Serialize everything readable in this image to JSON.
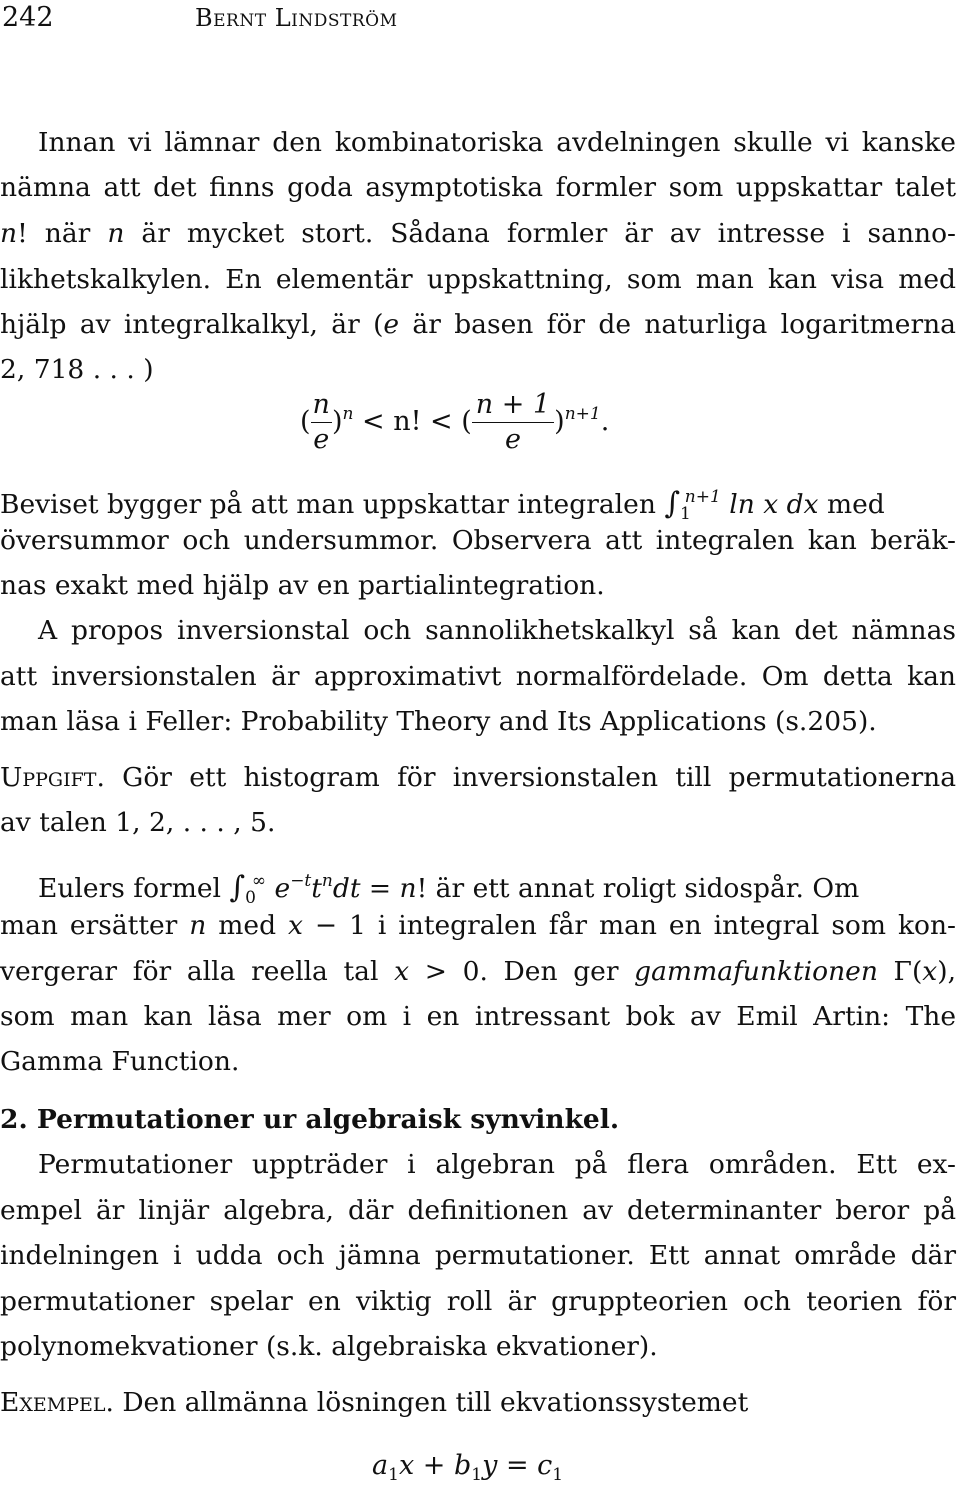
{
  "header": {
    "page_number": "242",
    "running_head": "Bernt Lindström"
  },
  "para1": {
    "l1": "Innan vi lämnar den kombinatoriska avdelningen skulle vi kanske",
    "l2": "nämna att det finns goda asymptotiska formler som uppskattar talet",
    "l3_a": "n",
    "l3_b": "! när ",
    "l3_c": "n",
    "l3_d": " är mycket stort. Sådana formler är av intresse i sanno-",
    "l4": "likhetskalkylen. En elementär uppskattning, som man kan visa med",
    "l5_a": "hjälp av integralkalkyl, är (",
    "l5_b": "e",
    "l5_c": " är basen för de naturliga logaritmerna",
    "l6": "2, 718 . . . )"
  },
  "formula1": {
    "open1": "(",
    "num1": "n",
    "den1": "e",
    "close1": ")",
    "exp1": "n",
    "middle": " < n! < (",
    "num2": "n + 1",
    "den2": "e",
    "close2": ")",
    "exp2": "n+1",
    "period": "."
  },
  "para2": {
    "l1_a": "Beviset bygger på att man uppskattar integralen",
    "l1_int": "∫",
    "l1_lower": "1",
    "l1_upper": "n+1",
    "l1_integrand": "ln x dx",
    "l1_b": "med",
    "l2": "översummor och undersummor. Observera att integralen kan beräk-",
    "l3": "nas exakt med hjälp av en partialintegration."
  },
  "para3": {
    "l1": "A propos inversionstal och sannolikhetskalkyl så kan det nämnas",
    "l2": "att inversionstalen är approximativt normalfördelade. Om detta kan",
    "l3": "man läsa i Feller: Probability Theory and Its Applications (s.205)."
  },
  "exercise": {
    "label": "Uppgift.",
    "l1": " Gör ett histogram för inversionstalen till permutationerna",
    "l2": "av talen 1, 2, . . . , 5."
  },
  "para4": {
    "l1_a": "Eulers formel",
    "l1_int": "∫",
    "l1_lower": "0",
    "l1_upper": "∞",
    "l1_e": "e",
    "l1_exp": "−t",
    "l1_t": "t",
    "l1_texp": "n",
    "l1_dt": "dt = n",
    "l1_b": "! är ett annat roligt sidospår. Om",
    "l2_a": "man ersätter ",
    "l2_n": "n",
    "l2_b": " med ",
    "l2_x": "x",
    "l2_c": " − 1 i integralen får man en integral som kon-",
    "l3_a": "vergerar för alla reella tal ",
    "l3_x": "x",
    "l3_b": " > 0. Den ger ",
    "l3_gamma": "gammafunktionen",
    "l3_c": " Γ(",
    "l3_x2": "x",
    "l3_d": "),",
    "l4": "som man kan läsa mer om i en intressant bok av Emil Artin: The",
    "l5": "Gamma Function."
  },
  "section": {
    "title": "2. Permutationer ur algebraisk synvinkel."
  },
  "para5": {
    "l1": "Permutationer uppträder i algebran på flera områden. Ett ex-",
    "l2": "empel är linjär algebra, där definitionen av determinanter beror på",
    "l3": "indelningen i udda och jämna permutationer. Ett annat område där",
    "l4": "permutationer spelar en viktig roll är gruppteorien och teorien för",
    "l5": "polynomekvationer (s.k. algebraiska ekvationer)."
  },
  "example": {
    "label": "Exempel.",
    "text": " Den allmänna lösningen till ekvationssystemet"
  },
  "formula2": {
    "a": "a",
    "a_sub": "1",
    "x": "x",
    "plus": " + ",
    "b": "b",
    "b_sub": "1",
    "y": "y",
    "eq": " = ",
    "c": "c",
    "c_sub": "1"
  }
}
